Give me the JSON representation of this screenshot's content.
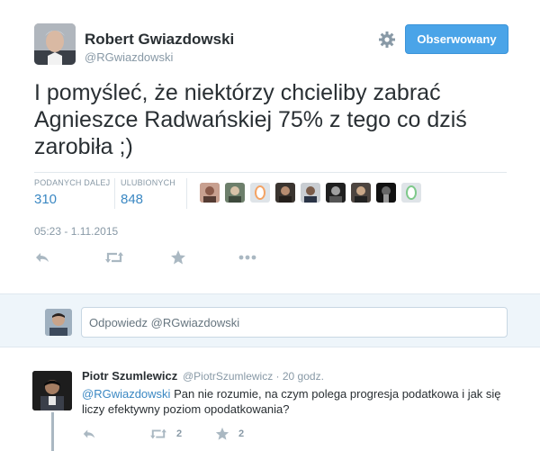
{
  "author": {
    "fullname": "Robert Gwiazdowski",
    "username": "@RGwiazdowski"
  },
  "follow_button_label": "Obserwowany",
  "tweet_text": "I pomyśleć, że niektórzy chcieliby zabrać Agnieszce Radwańskiej 75% z tego co dziś zarobiła ;)",
  "stats": {
    "retweets_label": "PODANYCH DALEJ",
    "retweets_value": "310",
    "favorites_label": "ULUBIONYCH",
    "favorites_value": "848"
  },
  "timestamp": "05:23 - 1.11.2015",
  "reply_box": {
    "placeholder": "Odpowiedz @RGwiazdowski"
  },
  "reply_tweet": {
    "fullname": "Piotr Szumlewicz",
    "handle_time": "@PiotrSzumlewicz · 20 godz.",
    "mention": "@RGwiazdowski",
    "text": " Pan nie rozumie, na czym polega progresja podatkowa i jak się liczy efektywny poziom opodatkowania?",
    "retweet_count": "2",
    "favorite_count": "2"
  },
  "colors": {
    "accent": "#4aa4e8",
    "link": "#3b88c3",
    "muted": "#8899a6"
  },
  "icons": [
    "gear-icon",
    "reply-icon",
    "retweet-icon",
    "favorite-icon",
    "more-icon"
  ]
}
